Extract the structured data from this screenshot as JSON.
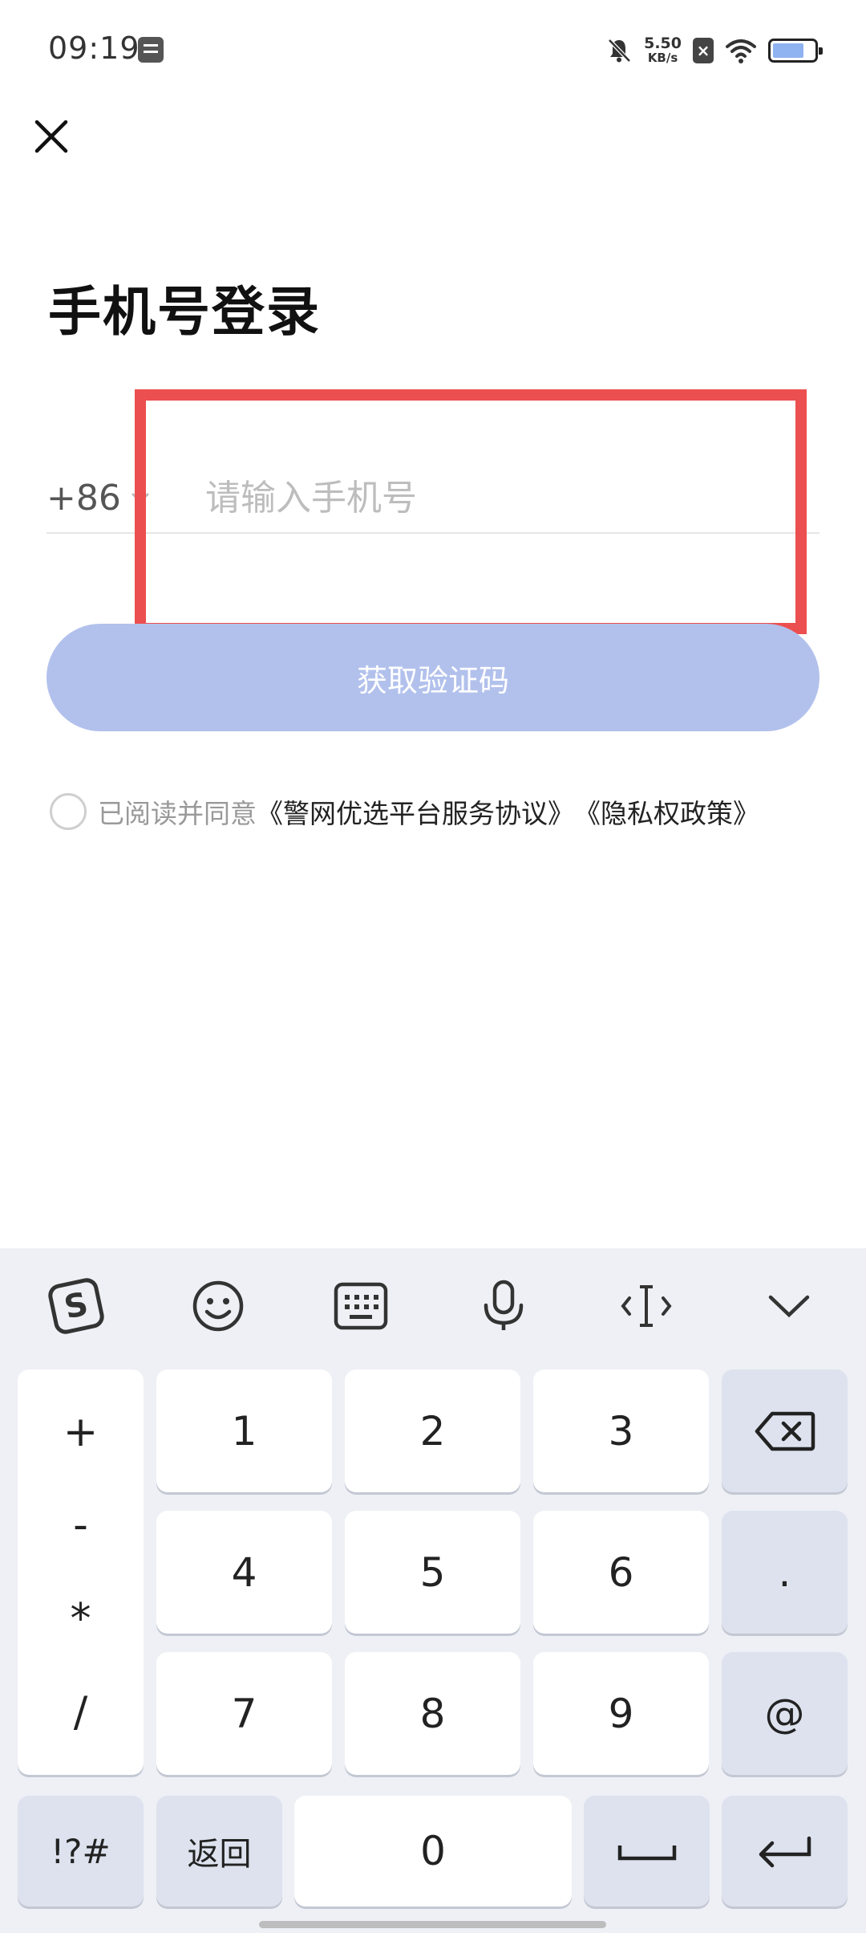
{
  "status_bar": {
    "time": "09:19",
    "net_speed_value": "5.50",
    "net_speed_unit": "KB/s",
    "battery_color": "#8fb2f0"
  },
  "header": {
    "close_icon": "close-icon",
    "title": "手机号登录"
  },
  "form": {
    "country_code": "+86",
    "phone_placeholder": "请输入手机号",
    "phone_value": "",
    "get_code_label": "获取验证码",
    "button_color": "#b2c1ec"
  },
  "agreement": {
    "prefix": "已阅读并同意",
    "service_link": "《警网优选平台服务协议》",
    "privacy_link": "《隐私权政策》"
  },
  "keyboard": {
    "toolbar_icons": [
      "sogou-logo-icon",
      "emoji-icon",
      "keyboard-icon",
      "microphone-icon",
      "cursor-icon",
      "collapse-icon"
    ],
    "symbols": [
      "+",
      "-",
      "*",
      "/"
    ],
    "digits": [
      "1",
      "2",
      "3",
      "4",
      "5",
      "6",
      "7",
      "8",
      "9",
      "0"
    ],
    "dot": ".",
    "at": "@",
    "symbol_switch": "!?#",
    "back_label": "返回"
  },
  "highlight_color": "#ec4f4f"
}
